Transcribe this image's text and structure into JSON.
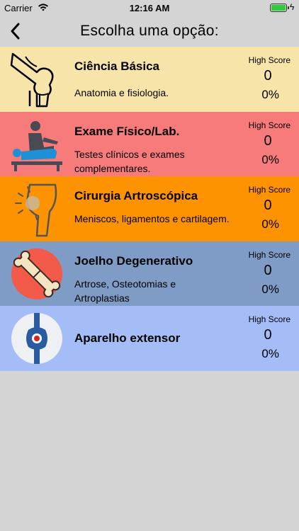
{
  "status_bar": {
    "carrier": "Carrier",
    "time": "12:16 AM",
    "battery_color": "#2ecc3a"
  },
  "nav": {
    "back_icon": "chevron-left-icon",
    "title": "Escolha uma opção:"
  },
  "options": [
    {
      "icon": "knee-bone-icon",
      "color": "#f7e4a9",
      "name": "Ciência Básica",
      "description": "Anatomia e fisiologia.",
      "high_score_label": "High Score",
      "score": "0",
      "percent": "0%"
    },
    {
      "icon": "physical-exam-icon",
      "color": "#f87b7b",
      "name": "Exame Físico/Lab.",
      "description": "Testes clínicos e exames complementares.",
      "high_score_label": "High Score",
      "score": "0",
      "percent": "0%"
    },
    {
      "icon": "arthroscopy-knee-icon",
      "color": "#fd9301",
      "name": "Cirurgia Artroscópica",
      "description": "Meniscos, ligamentos e cartilagem.",
      "high_score_label": "High Score",
      "score": "0",
      "percent": "0%"
    },
    {
      "icon": "degenerative-joint-icon",
      "color": "#7f9cc6",
      "name": "Joelho Degenerativo",
      "description": "Artrose, Osteotomias e Artroplastias",
      "high_score_label": "High Score",
      "score": "0",
      "percent": "0%"
    },
    {
      "icon": "extensor-apparatus-icon",
      "color": "#a5bdf7",
      "name": "Aparelho extensor",
      "description": "",
      "high_score_label": "High Score",
      "score": "0",
      "percent": "0%"
    }
  ]
}
